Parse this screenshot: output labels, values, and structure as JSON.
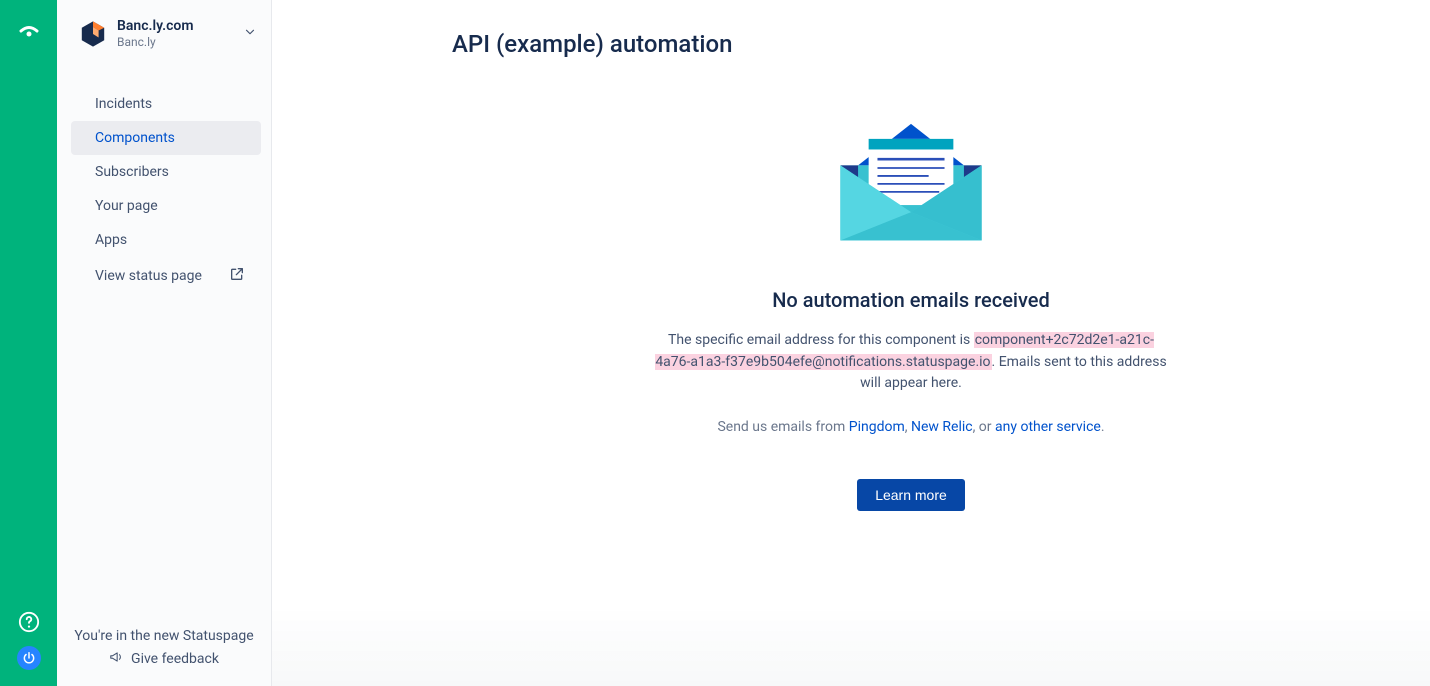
{
  "rail": {
    "top_icon": "app-launcher",
    "help_icon": "help",
    "power_icon": "power"
  },
  "org": {
    "title": "Banc.ly.com",
    "subtitle": "Banc.ly"
  },
  "nav": {
    "items": [
      {
        "label": "Incidents",
        "active": false,
        "external": false
      },
      {
        "label": "Components",
        "active": true,
        "external": false
      },
      {
        "label": "Subscribers",
        "active": false,
        "external": false
      },
      {
        "label": "Your page",
        "active": false,
        "external": false
      },
      {
        "label": "Apps",
        "active": false,
        "external": false
      },
      {
        "label": "View status page",
        "active": false,
        "external": true
      }
    ]
  },
  "sidebar_footer": {
    "note": "You're in the new Statuspage",
    "feedback": "Give feedback"
  },
  "main": {
    "title": "API (example) automation",
    "empty_heading": "No automation emails received",
    "para_prefix": "The specific email address for this component is ",
    "email": "component+2c72d2e1-a21c-4a76-a1a3-f37e9b504efe@notifications.statuspage.io",
    "para_suffix": ". Emails sent to this address will appear here.",
    "send_prefix": "Send us emails from ",
    "service1": "Pingdom",
    "sep1": ", ",
    "service2": "New Relic",
    "sep2": ", or ",
    "service3": "any other service",
    "send_suffix": ".",
    "learn_more": "Learn more"
  }
}
